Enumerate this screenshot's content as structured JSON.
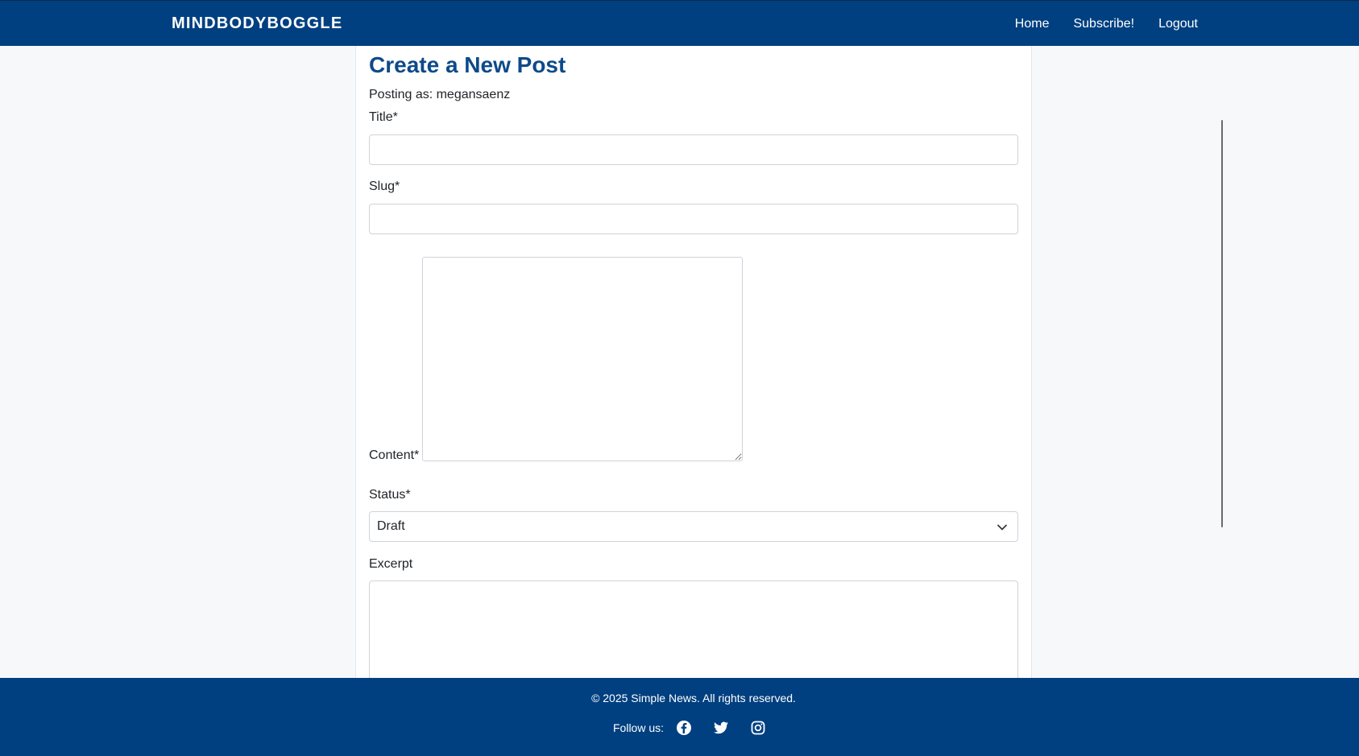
{
  "header": {
    "brand": "MINDBODYBOGGLE",
    "nav": [
      {
        "label": "Home"
      },
      {
        "label": "Subscribe!"
      },
      {
        "label": "Logout"
      }
    ]
  },
  "form": {
    "title": "Create a New Post",
    "posting_as": "Posting as: megansaenz",
    "fields": {
      "title_label": "Title*",
      "title_value": "",
      "slug_label": "Slug*",
      "slug_value": "",
      "content_label": "Content*",
      "content_value": "",
      "status_label": "Status*",
      "status_value": "Draft",
      "excerpt_label": "Excerpt",
      "excerpt_value": ""
    }
  },
  "footer": {
    "copyright": "© 2025 Simple News. All rights reserved.",
    "follow_label": "Follow us:",
    "social": [
      {
        "icon": "facebook-icon"
      },
      {
        "icon": "twitter-icon"
      },
      {
        "icon": "instagram-icon"
      }
    ]
  },
  "colors": {
    "header_bg": "#004080",
    "title": "#0d4a8a",
    "page_bg": "#f7f8fa"
  }
}
